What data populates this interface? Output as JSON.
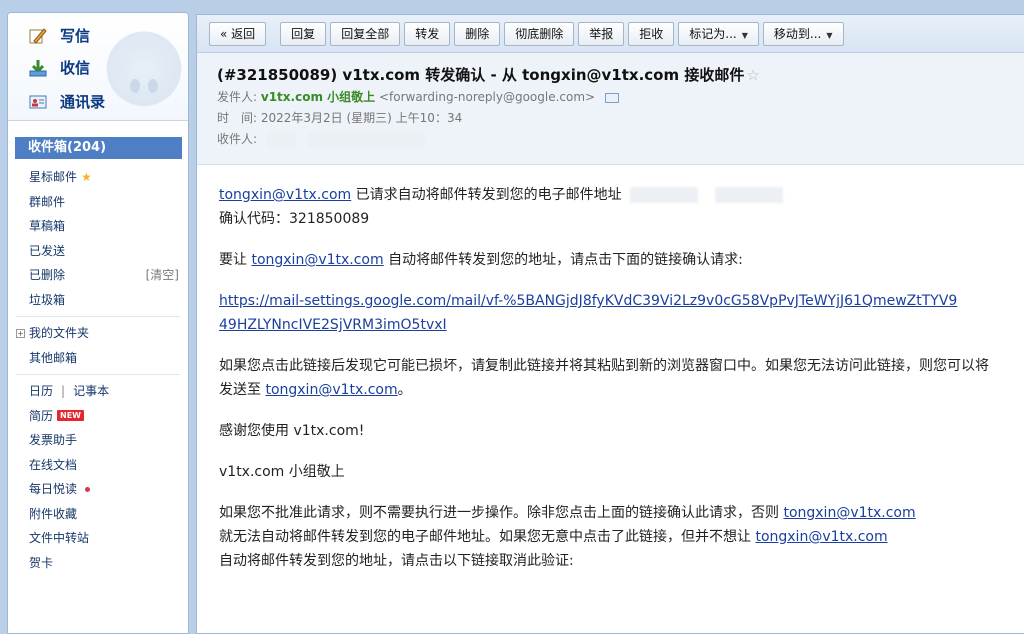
{
  "sidebar": {
    "compose": "写信",
    "receive": "收信",
    "contacts": "通讯录",
    "inbox": "收件箱(204)",
    "folders": [
      "星标邮件",
      "群邮件",
      "草稿箱",
      "已发送",
      "已删除",
      "垃圾箱"
    ],
    "clear": "[清空]",
    "my_folders": "我的文件夹",
    "other_mail": "其他邮箱",
    "calendar": "日历",
    "divider": "|",
    "notebook": "记事本",
    "resume": "简历",
    "new_badge": "NEW",
    "tools": [
      "发票助手",
      "在线文档",
      "每日悦读",
      "附件收藏",
      "文件中转站",
      "贺卡"
    ]
  },
  "toolbar": {
    "back": "« 返回",
    "reply": "回复",
    "reply_all": "回复全部",
    "forward": "转发",
    "delete": "删除",
    "perm_delete": "彻底删除",
    "report": "举报",
    "reject": "拒收",
    "mark_as": "标记为...",
    "move_to": "移动到..."
  },
  "email": {
    "subject": "(#321850089) v1tx.com 转发确认 - 从 tongxin@v1tx.com 接收邮件",
    "from_label": "发件人:",
    "from_name": "v1tx.com 小组敬上",
    "from_addr": "<forwarding-noreply@google.com>",
    "time_label": "时　间:",
    "time": "2022年3月2日 (星期三) 上午10：34",
    "to_label": "收件人:",
    "body": {
      "l1_link": "tongxin@v1tx.com",
      "l1_text": " 已请求自动将邮件转发到您的电子邮件地址",
      "l2": "确认代码：321850089",
      "l3_pre": "要让 ",
      "l3_link": "tongxin@v1tx.com",
      "l3_post": " 自动将邮件转发到您的地址，请点击下面的链接确认请求:",
      "url1": "https://mail-settings.google.com/mail/vf-%5BANGjdJ8fyKVdC39Vi2Lz9v0cG58VpPvJTeWYjJ61QmewZtTYV9",
      "url2": "49HZLYNncIVE2SjVRM3imO5tvxI",
      "p4a": "如果您点击此链接后发现它可能已损坏，请复制此链接并将其粘贴到新的浏览器窗口中。如果您无法访问此链接，则您可以将",
      "p4b_pre": "发送至 ",
      "p4b_link": "tongxin@v1tx.com",
      "p4b_post": "。",
      "thanks": "感谢您使用 v1tx.com!",
      "sign": "v1tx.com 小组敬上",
      "p7a_pre": "如果您不批准此请求，则不需要执行进一步操作。除非您点击上面的链接确认此请求，否则 ",
      "p7a_link": "tongxin@v1tx.com",
      "p7b_pre": "就无法自动将邮件转发到您的电子邮件地址。如果您无意中点击了此链接，但并不想让 ",
      "p7b_link": "tongxin@v1tx.com",
      "p7c": "自动将邮件转发到您的地址，请点击以下链接取消此验证:"
    }
  },
  "colors": {
    "accent": "#4e7fc4",
    "link": "#1a3f9e",
    "sender": "#3a8a26",
    "background": "#b9cfe8"
  }
}
